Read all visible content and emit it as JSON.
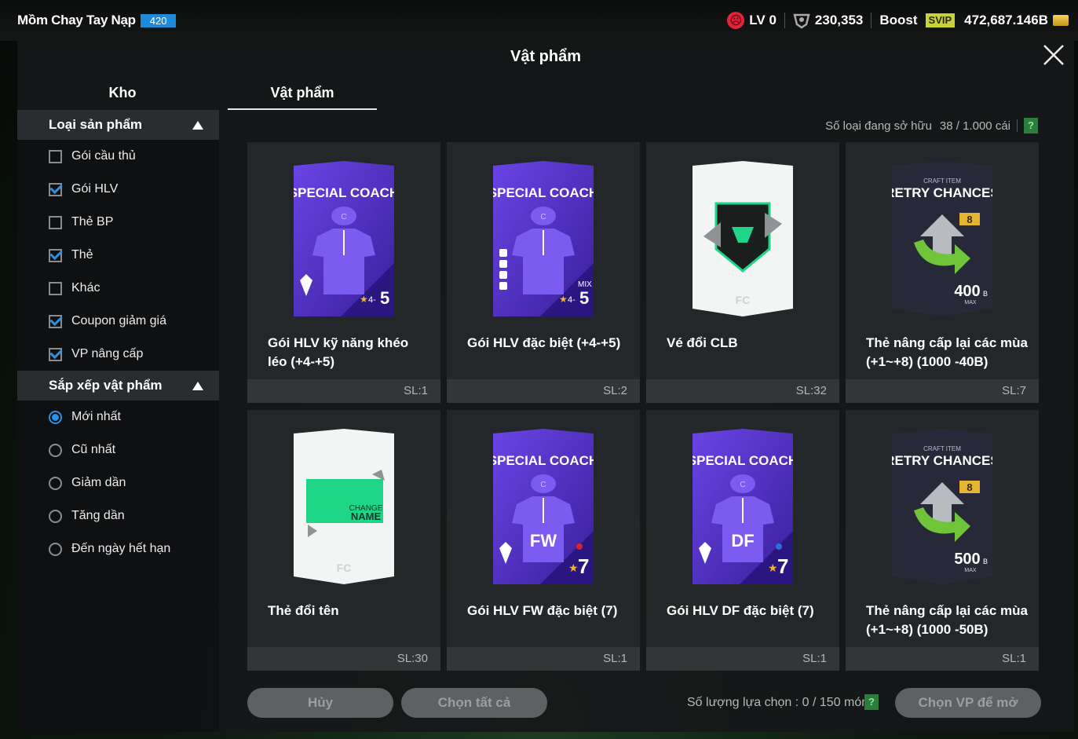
{
  "header": {
    "player_name": "Mồm Chay Tay Nạp",
    "level_badge": "420",
    "lv": "LV 0",
    "stat_value": "230,353",
    "boost_label": "Boost",
    "svip_label": "SVIP",
    "currency": "472,687.146B"
  },
  "panel": {
    "title": "Vật phẩm",
    "tabs": [
      {
        "label": "Kho",
        "active": false
      },
      {
        "label": "Vật phẩm",
        "active": true
      }
    ]
  },
  "sidebar": {
    "filter_header": "Loại sản phẩm",
    "filters": [
      {
        "label": "Gói cầu thủ",
        "checked": false
      },
      {
        "label": "Gói HLV",
        "checked": true
      },
      {
        "label": "Thẻ BP",
        "checked": false
      },
      {
        "label": "Thẻ",
        "checked": true
      },
      {
        "label": "Khác",
        "checked": false
      },
      {
        "label": "Coupon giảm giá",
        "checked": true
      },
      {
        "label": "VP nâng cấp",
        "checked": true
      }
    ],
    "sort_header": "Sắp xếp vật phẩm",
    "sorts": [
      {
        "label": "Mới nhất",
        "selected": true
      },
      {
        "label": "Cũ nhất",
        "selected": false
      },
      {
        "label": "Giảm dần",
        "selected": false
      },
      {
        "label": "Tăng dần",
        "selected": false
      },
      {
        "label": "Đến ngày hết hạn",
        "selected": false
      }
    ]
  },
  "owned": {
    "label": "Số loại đang sở hữu",
    "value": "38 / 1.000 cái",
    "help": "?"
  },
  "items": [
    {
      "name": "Gói HLV kỹ năng khéo léo (+4-+5)",
      "qty": "SL:1",
      "art": "coach",
      "art_title": "SPECIAL COACH",
      "rank": "5",
      "rank_prefix": "4-",
      "badge": ""
    },
    {
      "name": "Gói HLV đặc biệt (+4-+5)",
      "qty": "SL:2",
      "art": "coach-mix",
      "art_title": "SPECIAL COACH",
      "rank": "5",
      "rank_prefix": "4-",
      "badge": "MIX"
    },
    {
      "name": "Vé đổi CLB",
      "qty": "SL:32",
      "art": "club",
      "art_title": "",
      "rank": "",
      "rank_prefix": "",
      "badge": ""
    },
    {
      "name": "Thẻ nâng cấp lại các mùa (+1~+8) (1000 -40B)",
      "qty": "SL:7",
      "art": "retry",
      "art_title": "RETRY CHANCES",
      "craft": "CRAFT ITEM",
      "value": "400",
      "unit": "B",
      "max": "MAX",
      "lvl": "8"
    },
    {
      "name": "Thẻ đổi tên",
      "qty": "SL:30",
      "art": "rename",
      "art_title": "",
      "line1": "CHANGE",
      "line2": "NAME"
    },
    {
      "name": "Gói HLV FW đặc biệt (7)",
      "qty": "SL:1",
      "art": "coach-pos",
      "art_title": "SPECIAL COACH",
      "pos": "FW",
      "rank": "7",
      "dot": "#d8232f"
    },
    {
      "name": "Gói HLV DF đặc biệt (7)",
      "qty": "SL:1",
      "art": "coach-pos",
      "art_title": "SPECIAL COACH",
      "pos": "DF",
      "rank": "7",
      "dot": "#2d6fd8"
    },
    {
      "name": "Thẻ nâng cấp lại các mùa (+1~+8) (1000 -50B)",
      "qty": "SL:1",
      "art": "retry",
      "art_title": "RETRY CHANCES",
      "craft": "CRAFT ITEM",
      "value": "500",
      "unit": "B",
      "max": "MAX",
      "lvl": "8"
    }
  ],
  "footer": {
    "cancel": "Hủy",
    "select_all": "Chọn tất cả",
    "select_count": "Số lượng lựa chọn : 0 / 150 món",
    "help": "?",
    "open": "Chọn VP để mở"
  },
  "colors": {
    "accent": "#2f8fe0",
    "coach_purple": "#5b32d6",
    "help_green": "#2a7d3a"
  }
}
